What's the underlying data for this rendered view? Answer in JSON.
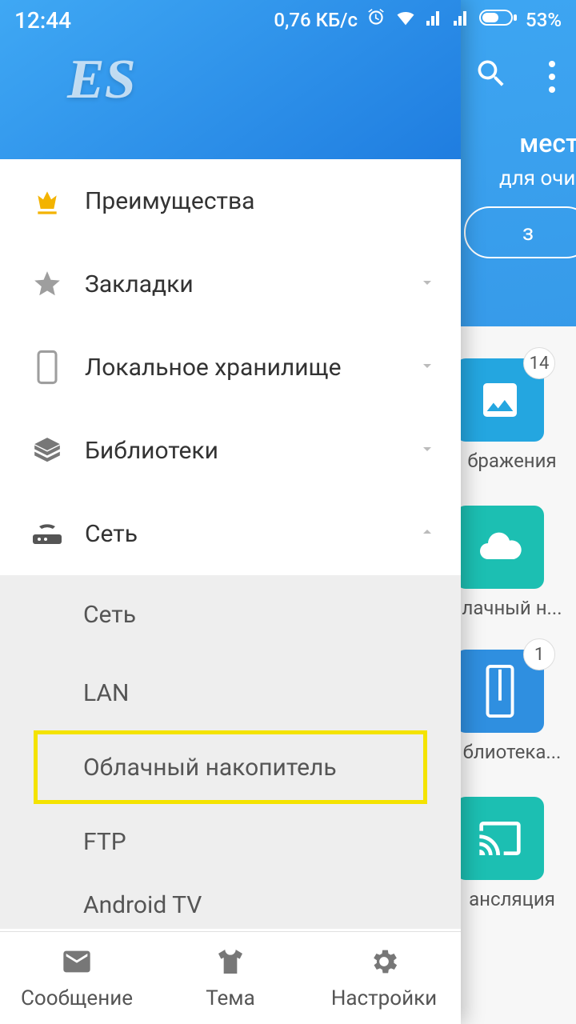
{
  "status": {
    "time": "12:44",
    "network_rate": "0,76 КБ/с",
    "battery_pct": "53%"
  },
  "promo": {
    "title": "места",
    "subtitle": "для очи...",
    "button": "з"
  },
  "tiles": {
    "images": {
      "label": "бражения",
      "badge": "14"
    },
    "cloud": {
      "label": "лачный н..."
    },
    "zip": {
      "label": "блиотека...",
      "badge": "1"
    },
    "cast": {
      "label": "ансляция"
    }
  },
  "drawer": {
    "logo": "ES",
    "items": {
      "premium": "Преимущества",
      "bookmarks": "Закладки",
      "local": "Локальное хранилище",
      "libraries": "Библиотеки",
      "network": "Сеть"
    },
    "network_sub": {
      "net": "Сеть",
      "lan": "LAN",
      "cloud": "Облачный накопитель",
      "ftp": "FTP",
      "atv": "Android TV"
    }
  },
  "bottom_nav": {
    "msg": "Сообщение",
    "theme": "Тема",
    "settings": "Настройки"
  }
}
